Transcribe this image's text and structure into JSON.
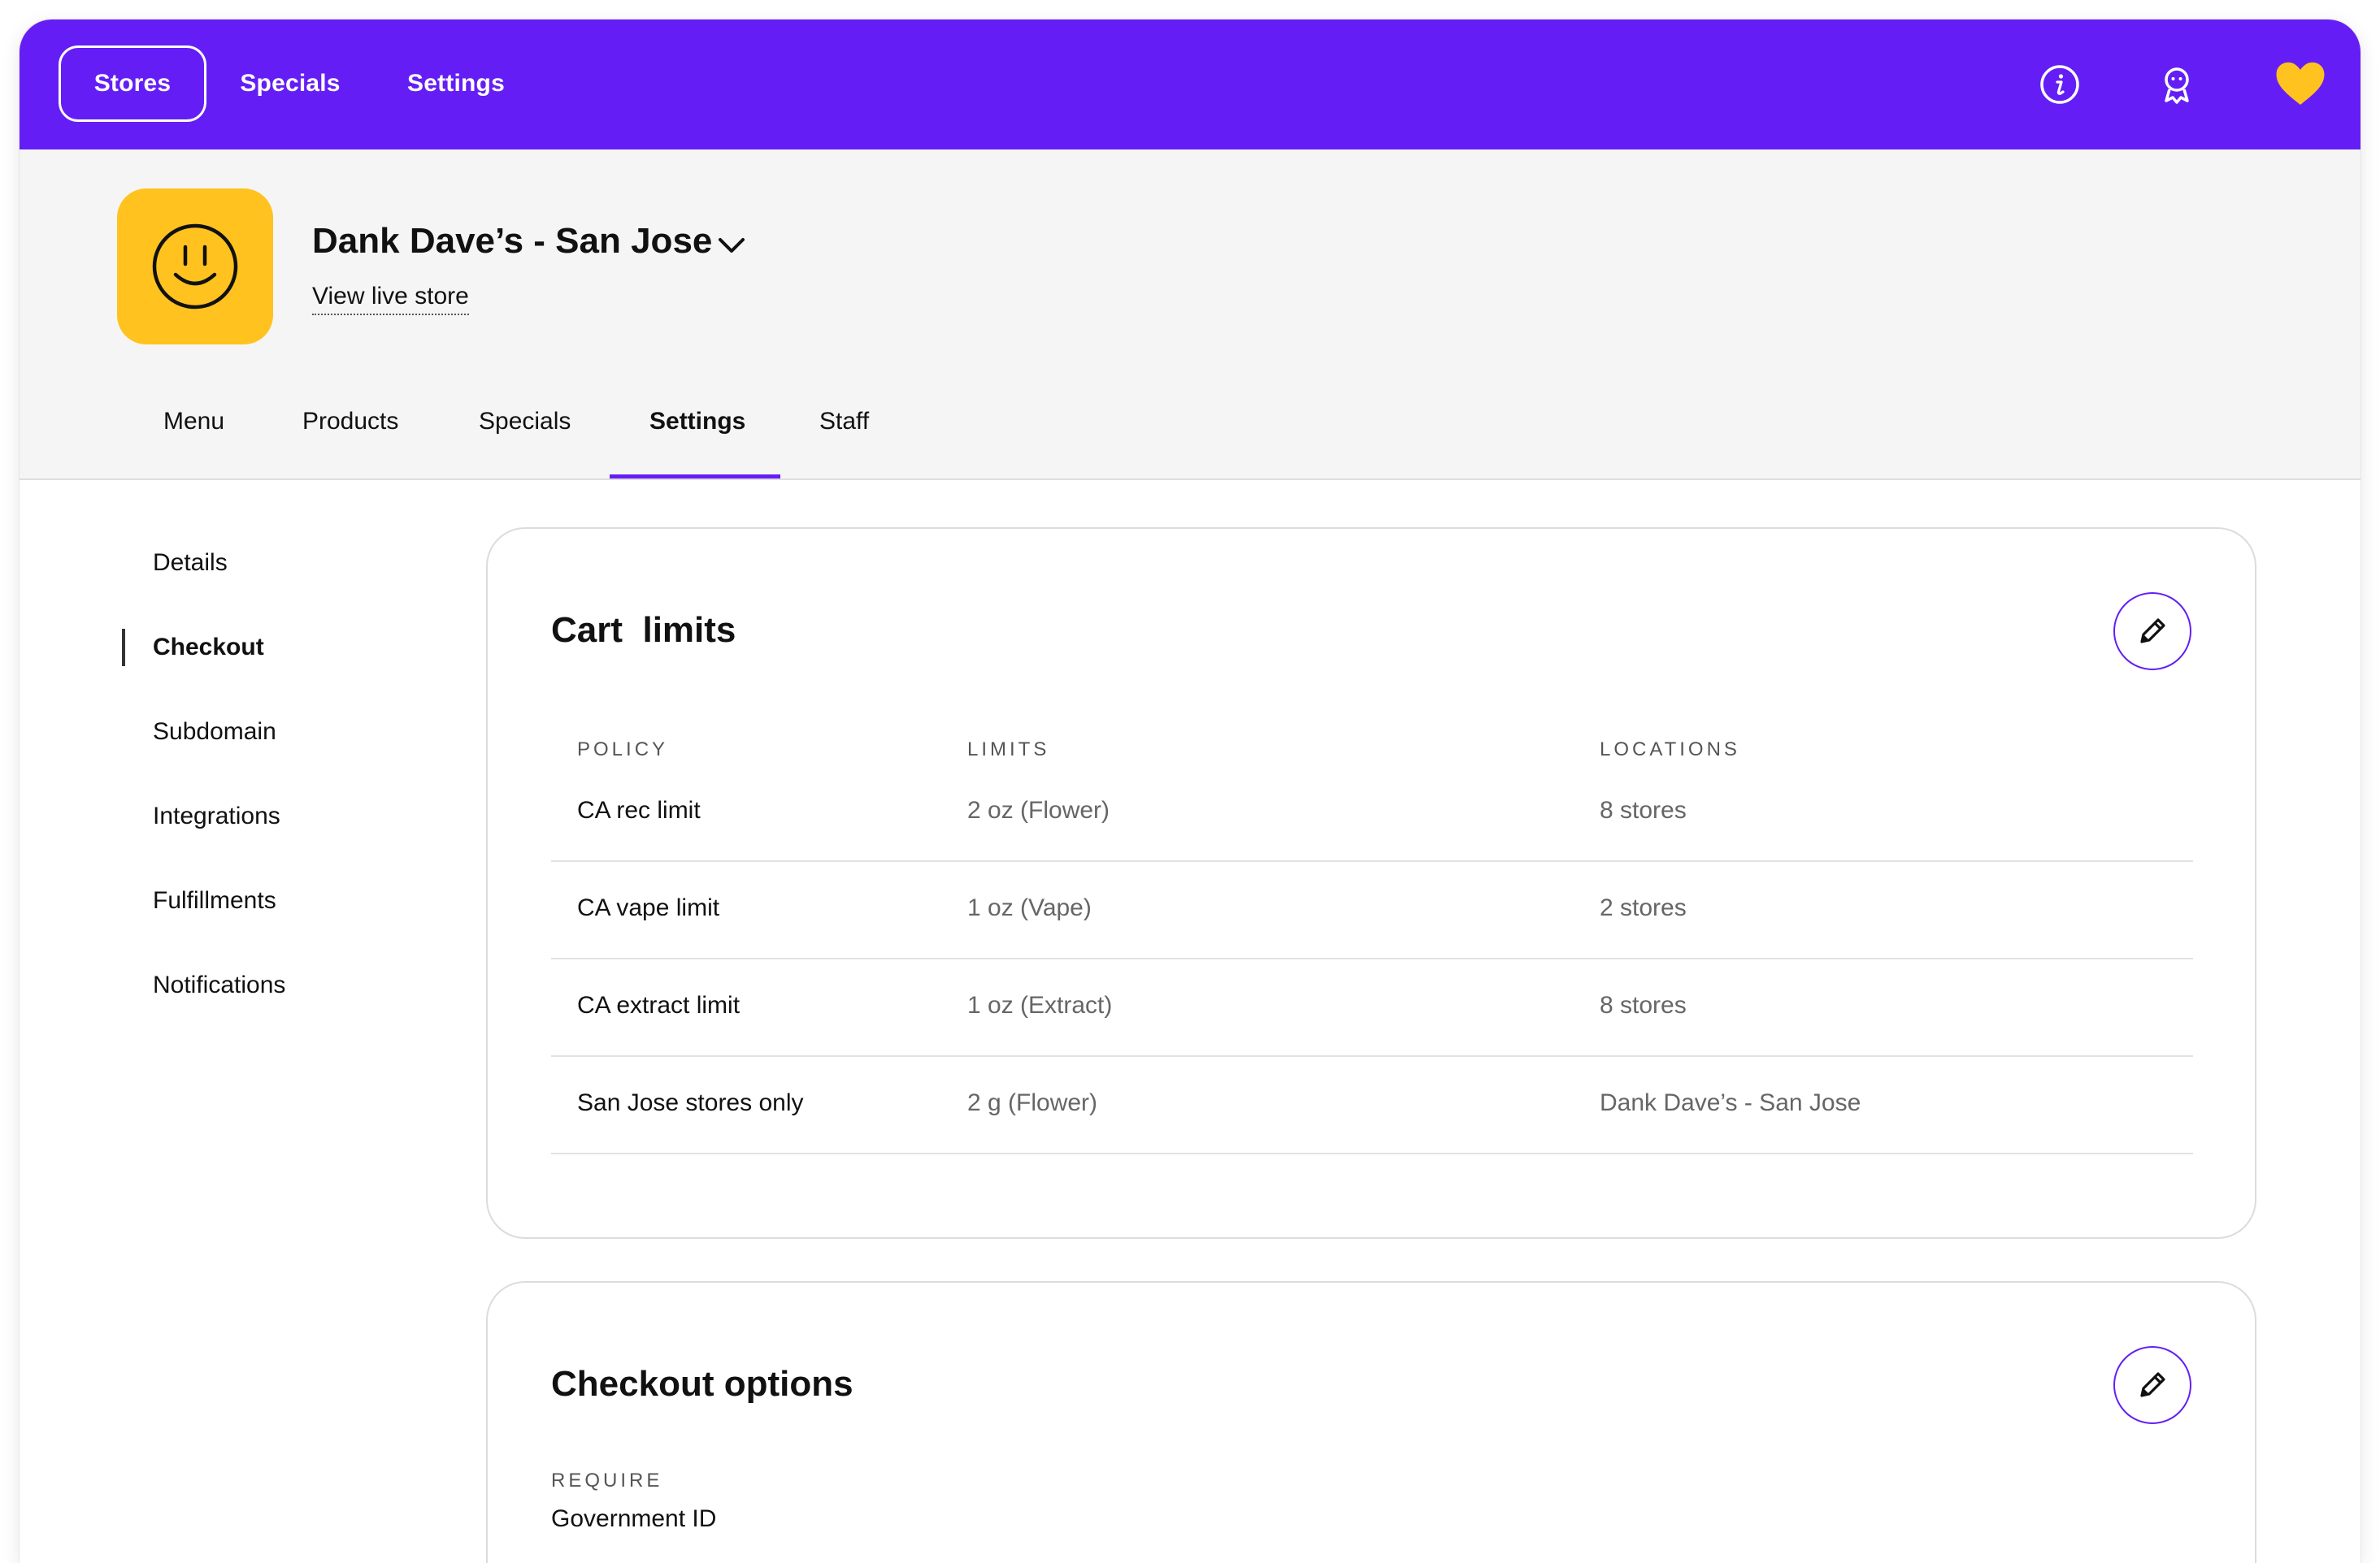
{
  "topnav": {
    "items": [
      {
        "label": "Stores",
        "active": true
      },
      {
        "label": "Specials",
        "active": false
      },
      {
        "label": "Settings",
        "active": false
      }
    ],
    "icons": [
      "info-icon",
      "user-icon",
      "heart-icon"
    ]
  },
  "store": {
    "name": "Dank Dave’s - San Jose",
    "view_live": "View live store"
  },
  "subnav": {
    "tabs": [
      {
        "label": "Menu",
        "active": false
      },
      {
        "label": "Products",
        "active": false
      },
      {
        "label": "Specials",
        "active": false
      },
      {
        "label": "Settings",
        "active": true
      },
      {
        "label": "Staff",
        "active": false
      }
    ]
  },
  "sidebar": {
    "items": [
      {
        "label": "Details",
        "active": false
      },
      {
        "label": "Checkout",
        "active": true
      },
      {
        "label": "Subdomain",
        "active": false
      },
      {
        "label": "Integrations",
        "active": false
      },
      {
        "label": "Fulfillments",
        "active": false
      },
      {
        "label": "Notifications",
        "active": false
      }
    ]
  },
  "cart_limits": {
    "title": "Cart  limits",
    "columns": [
      "POLICY",
      "LIMITS",
      "LOCATIONS"
    ],
    "rows": [
      {
        "policy": "CA rec limit",
        "limit": "2 oz (Flower)",
        "locations": "8 stores"
      },
      {
        "policy": "CA vape limit",
        "limit": "1 oz (Vape)",
        "locations": "2 stores"
      },
      {
        "policy": "CA extract limit",
        "limit": "1 oz (Extract)",
        "locations": "8 stores"
      },
      {
        "policy": "San Jose stores only",
        "limit": "2 g (Flower)",
        "locations": "Dank Dave’s - San Jose"
      }
    ]
  },
  "checkout_options": {
    "title": "Checkout options",
    "require_label": "REQUIRE",
    "require_value": "Government ID"
  },
  "colors": {
    "brand_purple": "#641ef5",
    "logo_yellow": "#ffc21f",
    "heart_yellow": "#ffc21f",
    "header_grey": "#f5f5f5"
  }
}
